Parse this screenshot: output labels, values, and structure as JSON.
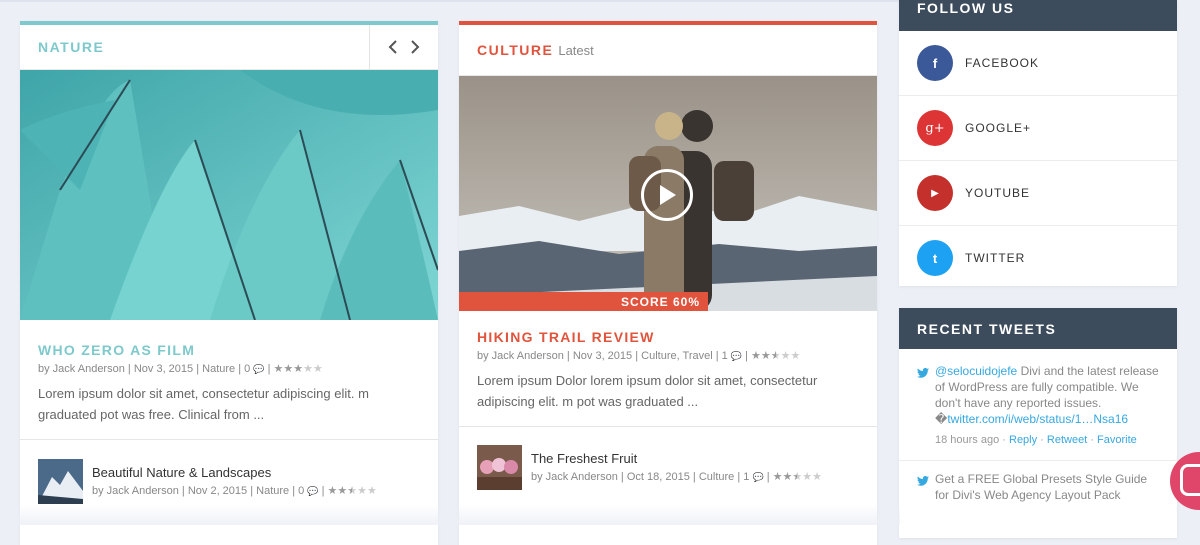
{
  "nature": {
    "category": "NATURE",
    "post": {
      "title": "WHO ZERO AS FILM",
      "author": "by Jack Anderson",
      "date": "Nov 3, 2015",
      "category": "Nature",
      "comments": "0",
      "rating": 3,
      "excerpt": "Lorem ipsum dolor sit amet, consectetur adipiscing elit. m graduated pot was free. Clinical from ..."
    },
    "mini": {
      "title": "Beautiful Nature & Landscapes",
      "author": "by Jack Anderson",
      "date": "Nov 2, 2015",
      "category": "Nature",
      "comments": "0",
      "rating": 2.5
    }
  },
  "culture": {
    "category": "CULTURE",
    "subtitle": "Latest",
    "score_label": "SCORE 60%",
    "score_value": 0.6,
    "post": {
      "title": "HIKING TRAIL REVIEW",
      "author": "by Jack Anderson",
      "date": "Nov 3, 2015",
      "category": "Culture, Travel",
      "comments": "1",
      "rating": 2.5,
      "excerpt": "Lorem ipsum Dolor lorem ipsum dolor sit amet, consectetur adipiscing elit. m pot was graduated ..."
    },
    "mini": {
      "title": "The Freshest Fruit",
      "author": "by Jack Anderson",
      "date": "Oct 18, 2015",
      "category": "Culture",
      "comments": "1",
      "rating": 2.5
    }
  },
  "follow": {
    "title": "FOLLOW US",
    "items": [
      {
        "label": "FACEBOOK",
        "icon": "f",
        "color": "#3b5998"
      },
      {
        "label": "GOOGLE+",
        "icon": "g+",
        "color": "#dd3535"
      },
      {
        "label": "YOUTUBE",
        "icon": "▶",
        "color": "#c4302b"
      },
      {
        "label": "TWITTER",
        "icon": "t",
        "color": "#1da1f2"
      }
    ]
  },
  "tweets": {
    "title": "RECENT TWEETS",
    "t1": {
      "handle": "@selocuidojefe",
      "text": " Divi and the latest release of WordPress are fully compatible. We don't have any reported issues. �",
      "link": "twitter.com/i/web/status/1…Nsa16",
      "time": "18 hours ago",
      "reply": "Reply",
      "retweet": "Retweet",
      "favorite": "Favorite"
    },
    "t2": {
      "text": "Get a FREE Global Presets Style Guide for Divi's Web Agency Layout Pack"
    }
  }
}
